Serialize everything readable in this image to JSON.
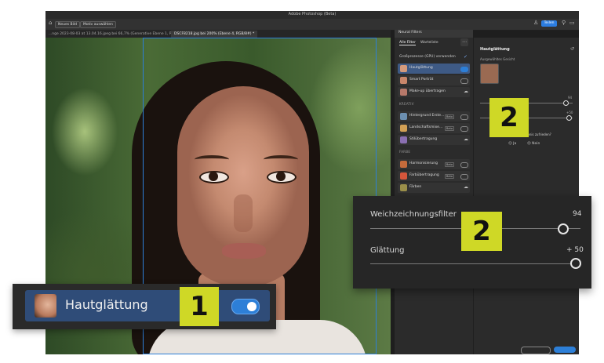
{
  "app": {
    "title": "Adobe Photoshop (Beta)",
    "options": [
      "Neues Bild",
      "Motiv auswählen"
    ],
    "share": "Teilen",
    "tabs": [
      {
        "label": "...nge 2023-08-03 at 13.04.16.jpeg bei 66,7% (Generative Ebene 1, RGB/8#) *"
      },
      {
        "label": "DSCF8218.jpg bei 200% (Ebene 4, RGB/8#) *"
      }
    ]
  },
  "neural_filters": {
    "panel_title": "Neural Filters",
    "tabs": [
      "Alle Filter",
      "Wartelistе"
    ],
    "gpu_label": "Großprozesse (GPU) verwenden",
    "items": [
      {
        "label": "Hautglättung",
        "state": "on",
        "color": "#d49a7c"
      },
      {
        "label": "Smart Porträt",
        "state": "off",
        "color": "#c9866a"
      },
      {
        "label": "Make-up übertragen",
        "state": "cloud",
        "color": "#b7796a"
      },
      {
        "label": "Hintergrund Erste...",
        "state": "beta",
        "color": "#6c8fb0"
      },
      {
        "label": "Landschaftsmixe...",
        "state": "beta",
        "color": "#d2a055"
      },
      {
        "label": "Stilübertragung",
        "state": "cloud",
        "color": "#8a6fb1"
      },
      {
        "label": "Harmonisierung",
        "state": "beta",
        "color": "#c66b3b"
      },
      {
        "label": "Farbübertragung",
        "state": "beta",
        "color": "#d6563b"
      },
      {
        "label": "Färben",
        "state": "cloud",
        "color": "#9b8f4a"
      }
    ],
    "categories": [
      "KREATIV",
      "FARBE"
    ]
  },
  "settings_panel": {
    "title": "Hautglättung",
    "selected_face_label": "Ausgewähltes Gesicht",
    "value_top": "94",
    "value_bottom": "+50",
    "question": "...ebnis zufrieden?",
    "yes": "Ja",
    "no": "Nein"
  },
  "callouts": {
    "one": "1",
    "two": "2"
  },
  "zoom_sliders": {
    "weich_label": "Weichzeichnungsfilter",
    "weich_value": "94",
    "glatt_label": "Glättung",
    "glatt_value": "+ 50"
  },
  "pill": {
    "label": "Hautglättung"
  },
  "colors": {
    "accent": "#2d7fd7",
    "callout": "#cfd826",
    "selected_row": "#3e5a85"
  }
}
